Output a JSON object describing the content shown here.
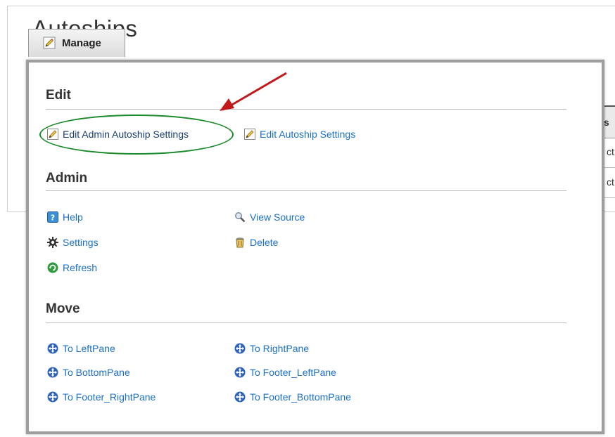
{
  "background": {
    "title": "Autoships",
    "table_header_fragment": "s",
    "row_fragments": [
      "ct",
      "ct"
    ]
  },
  "manage": {
    "label": "Manage",
    "icon": "pencil-icon"
  },
  "sections": {
    "edit": {
      "title": "Edit",
      "items": [
        {
          "label": "Edit Admin Autoship Settings",
          "icon": "pencil-icon",
          "highlighted": true
        },
        {
          "label": "Edit Autoship Settings",
          "icon": "pencil-icon"
        }
      ]
    },
    "admin": {
      "title": "Admin",
      "items": [
        {
          "label": "Help",
          "icon": "help-icon"
        },
        {
          "label": "View Source",
          "icon": "magnifier-icon"
        },
        {
          "label": "Settings",
          "icon": "gear-icon"
        },
        {
          "label": "Delete",
          "icon": "trash-icon"
        },
        {
          "label": "Refresh",
          "icon": "refresh-icon"
        }
      ]
    },
    "move": {
      "title": "Move",
      "items": [
        {
          "label": "To LeftPane",
          "icon": "move-arrows-icon"
        },
        {
          "label": "To RightPane",
          "icon": "move-arrows-icon"
        },
        {
          "label": "To BottomPane",
          "icon": "move-arrows-icon"
        },
        {
          "label": "To Footer_LeftPane",
          "icon": "move-arrows-icon"
        },
        {
          "label": "To Footer_RightPane",
          "icon": "move-arrows-icon"
        },
        {
          "label": "To Footer_BottomPane",
          "icon": "move-arrows-icon"
        }
      ]
    }
  },
  "colors": {
    "link": "#1b6fc7",
    "highlight_oval": "#1a8a2a",
    "annotation_arrow": "#c0181b",
    "panel_border": "#9e9e9e"
  }
}
